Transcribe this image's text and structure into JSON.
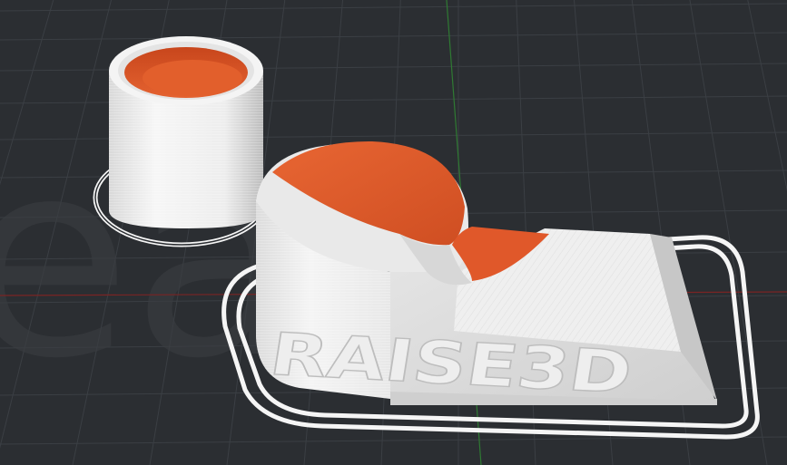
{
  "viewport": {
    "label": "",
    "background_color": "#2b2e32"
  },
  "watermark": {
    "text": "ea",
    "color": "#3a3d41"
  },
  "grid": {
    "line_color": "#3b3f44",
    "axis_x_color": "#8a2a2a",
    "axis_y_color": "#2f7a33"
  },
  "models": {
    "cup": {
      "wall_color": "#f2f2f2",
      "infill_color": "#e0582a"
    },
    "base_part": {
      "wall_color": "#f2f2f2",
      "top_color": "#e0582a",
      "embossed_text": "RAISE3D"
    }
  },
  "skirt": {
    "color": "#f5f5f5"
  }
}
